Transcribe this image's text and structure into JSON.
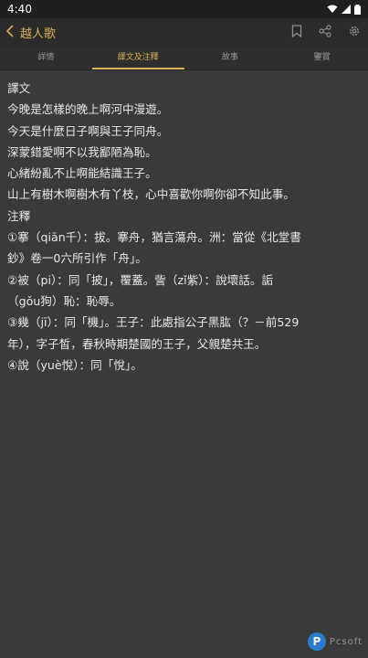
{
  "status": {
    "time": "4:40"
  },
  "header": {
    "title": "越人歌"
  },
  "icons": [
    "back-icon",
    "bookmark-icon",
    "share-icon",
    "settings-icon",
    "wifi-icon",
    "signal-icon",
    "battery-icon"
  ],
  "tabs": [
    {
      "label": "詳情"
    },
    {
      "label": "譯文及注釋"
    },
    {
      "label": "故事"
    },
    {
      "label": "鑒賞"
    }
  ],
  "content": {
    "lines": [
      "譯文",
      "今晚是怎樣的晚上啊河中漫遊。",
      "今天是什麼日子啊與王子同舟。",
      "深蒙錯愛啊不以我鄙陋為恥。",
      "心緒紛亂不止啊能結識王子。",
      "山上有樹木啊樹木有丫枝，心中喜歡你啊你卻不知此事。",
      "注釋",
      "①搴（qiān千）：拔。搴舟，猶言蕩舟。洲：當從《北堂書",
      "鈔》卷一0六所引作「舟」。",
      "②被（pi）：同「披」，覆蓋。訾（zǐ紫）：說壞話。詬",
      "（gǒu狗）恥：恥辱。",
      "③幾（jī）：同「機」。王子：此處指公子黑肱（？－前529",
      "年），字子皙，春秋時期楚國的王子，父親楚共王。",
      "④說（yuè悅）：同「悅」。"
    ]
  },
  "watermark": {
    "logo": "P",
    "text": "Pcsoft"
  }
}
